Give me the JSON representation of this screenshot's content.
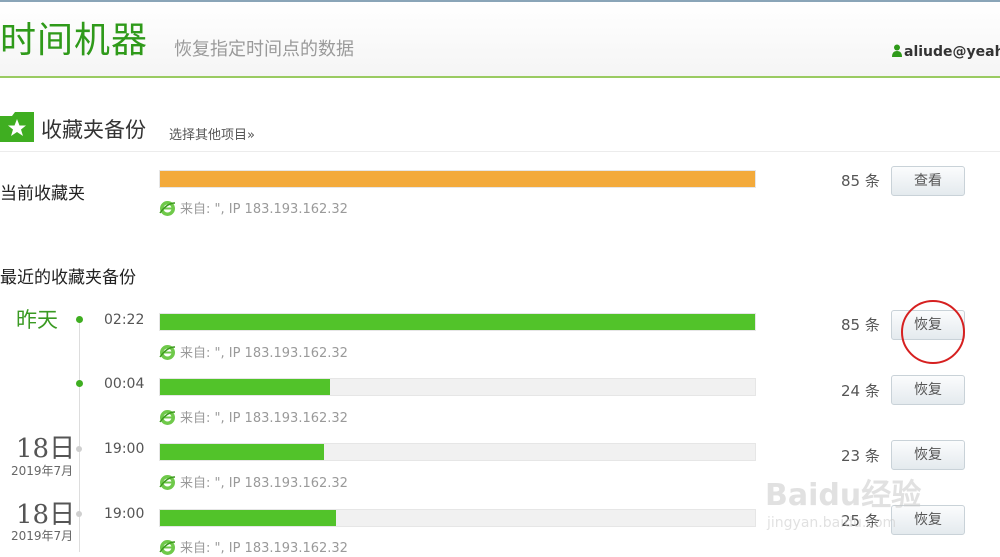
{
  "header": {
    "title": "时间机器",
    "subtitle": "恢复指定时间点的数据",
    "user": "aliude@yeah"
  },
  "section": {
    "title": "收藏夹备份",
    "link": "选择其他项目»"
  },
  "current": {
    "label": "当前收藏夹",
    "fill_fraction": 1.0,
    "bar_color": "#f3aa3b",
    "source": "来自: \", IP 183.193.162.32",
    "count": "85 条",
    "button": "查看"
  },
  "recent": {
    "label": "最近的收藏夹备份",
    "bar_color": "#52c32a",
    "items": [
      {
        "day": "昨天",
        "date_big": "",
        "date_small": "",
        "time": "02:22",
        "fill_fraction": 1.0,
        "source": "来自: \", IP 183.193.162.32",
        "count": "85 条",
        "button": "恢复"
      },
      {
        "day": "",
        "date_big": "",
        "date_small": "",
        "time": "00:04",
        "fill_fraction": 0.285,
        "source": "来自: \", IP 183.193.162.32",
        "count": "24 条",
        "button": "恢复"
      },
      {
        "day": "",
        "date_big": "18日",
        "date_small": "2019年7月",
        "time": "19:00",
        "fill_fraction": 0.275,
        "source": "来自: \", IP 183.193.162.32",
        "count": "23 条",
        "button": "恢复"
      },
      {
        "day": "",
        "date_big": "18日",
        "date_small": "2019年7月",
        "time": "19:00",
        "fill_fraction": 0.295,
        "source": "来自: \", IP 183.193.162.32",
        "count": "25 条",
        "button": "恢复"
      }
    ]
  },
  "watermark": {
    "logo": "Baidu经验",
    "url": "jingyan.baidu.com"
  },
  "colors": {
    "accent_green": "#2f9a1a",
    "annotation_red": "#d62020"
  }
}
